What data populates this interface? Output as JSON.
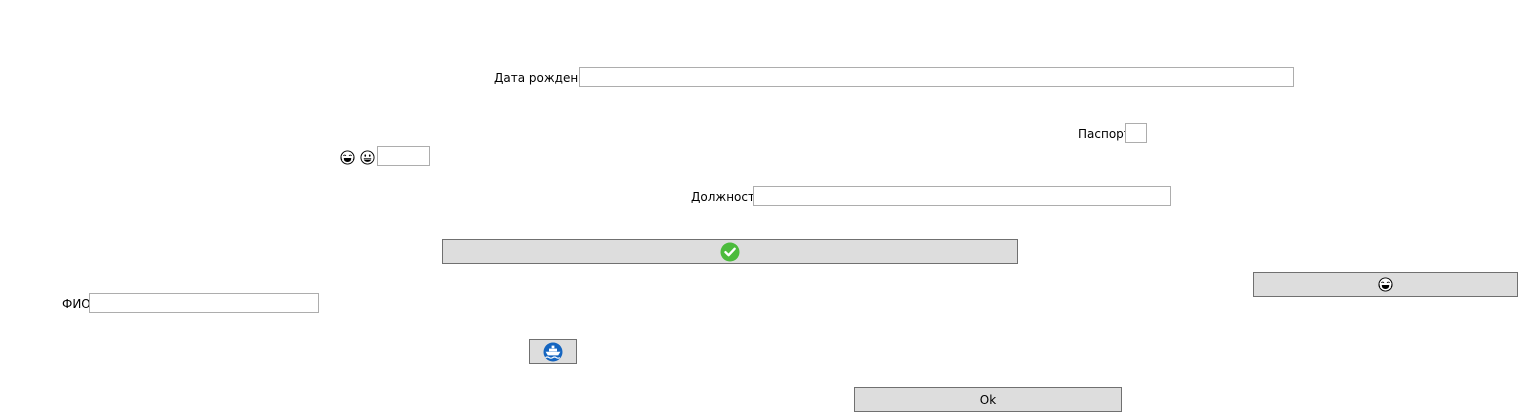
{
  "form": {
    "birth_date": {
      "label": "Дата рождения",
      "value": ""
    },
    "passport": {
      "label": "Паспорт",
      "value": ""
    },
    "emoji_field": {
      "value": ""
    },
    "position": {
      "label": "Должность",
      "value": ""
    },
    "full_name": {
      "label": "ФИО",
      "value": ""
    }
  },
  "buttons": {
    "ok_label": "Ok",
    "confirm_icon": "green-checkmark-icon",
    "laugh_icon": "face-with-tears-of-joy-icon",
    "ship_icon": "ship-icon"
  },
  "icons": {
    "emoji_label": [
      "face-with-tears-of-joy-icon",
      "grinning-face-icon"
    ]
  },
  "colors": {
    "button_bg": "#dddddd",
    "button_border": "#707070",
    "textbox_border": "#adadad",
    "check_green": "#4cbb3c",
    "ship_blue": "#1565c0"
  }
}
